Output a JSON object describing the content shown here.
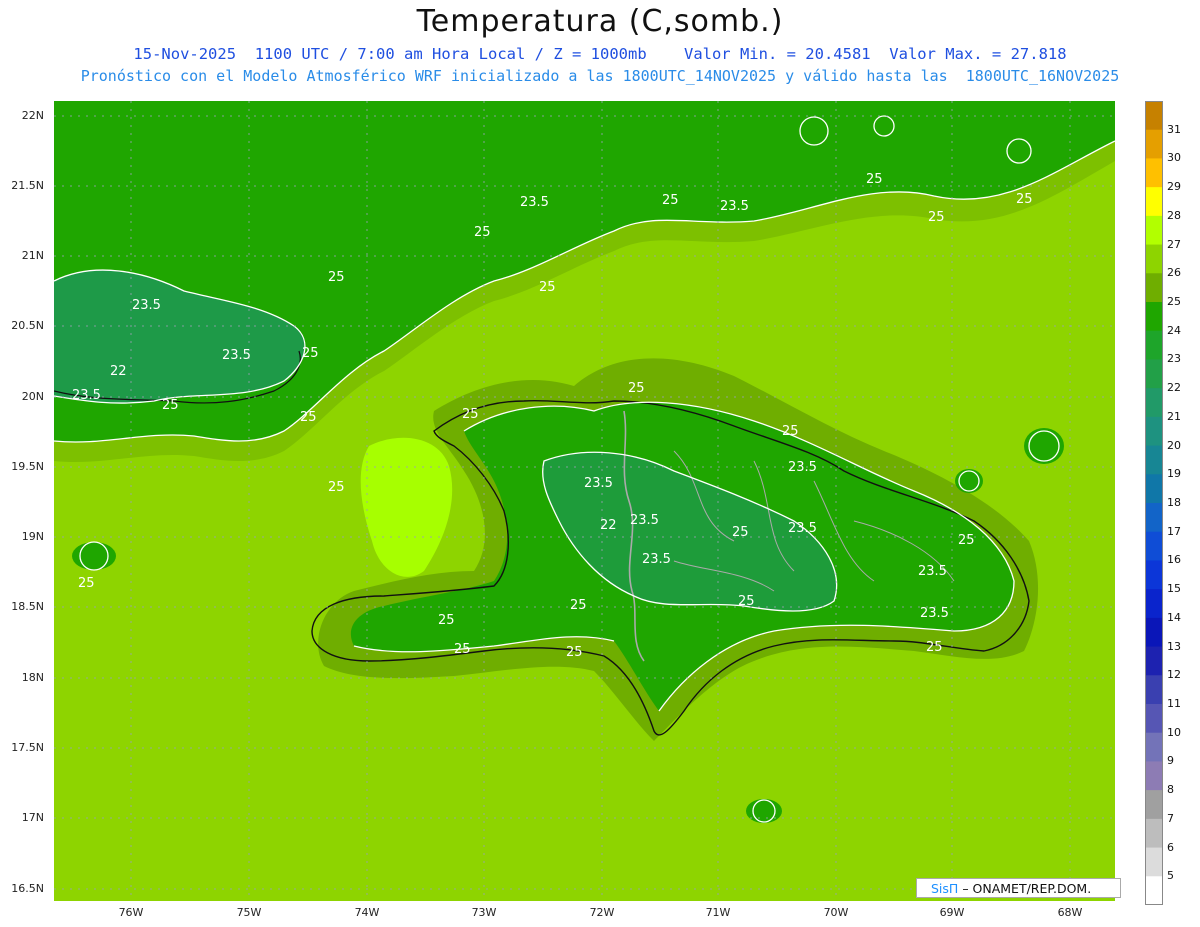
{
  "header": {
    "title": "Temperatura (C,somb.)",
    "subtitle_1": "15-Nov-2025  1100 UTC / 7:00 am Hora Local / Z = 1000mb    Valor Min. = 20.4581  Valor Max. = 27.818",
    "subtitle_2": "Pronóstico con el Modelo Atmosférico WRF inicializado a las 1800UTC_14NOV2025 y válido hasta las  1800UTC_16NOV2025"
  },
  "axes": {
    "y_labels": [
      "22N",
      "21.5N",
      "21N",
      "20.5N",
      "20N",
      "19.5N",
      "19N",
      "18.5N",
      "18N",
      "17.5N",
      "17N",
      "16.5N"
    ],
    "x_labels": [
      "76W",
      "75W",
      "74W",
      "73W",
      "72W",
      "71W",
      "70W",
      "69W",
      "68W"
    ]
  },
  "colorbar": {
    "labels": [
      "31",
      "30",
      "29",
      "28",
      "27",
      "26",
      "25",
      "24",
      "23",
      "22",
      "21",
      "20",
      "19",
      "18",
      "17",
      "16",
      "15",
      "14",
      "13",
      "12",
      "11",
      "10",
      "9",
      "8",
      "7",
      "6",
      "5"
    ],
    "colors": [
      "#c68100",
      "#e59f00",
      "#ffc000",
      "#ffff00",
      "#b2ff00",
      "#8ed400",
      "#6fae00",
      "#1fa600",
      "#1ea52a",
      "#22a048",
      "#219a68",
      "#1e9280",
      "#178694",
      "#1077a8",
      "#1264c8",
      "#0f4dd6",
      "#0c36d8",
      "#0a24cc",
      "#0a16b8",
      "#1d22b0",
      "#3a40b0",
      "#5656b4",
      "#7373b8",
      "#8d7cb4",
      "#a0a0a0",
      "#bdbdbd",
      "#dcdcdc",
      "#ffffff"
    ]
  },
  "contour_labels": [
    "25",
    "23.5",
    "22"
  ],
  "credit": {
    "brand": "SisΠ",
    "text": "– ONAMET/REP.DOM."
  },
  "colors": {
    "sea": "#8ed400",
    "sea_light": "#a7ff00",
    "land_low": "#6fae00",
    "land_mid": "#1fa600",
    "land_high": "#1e9a48",
    "contour": "#ffffff",
    "coast": "#111111",
    "border": "#aaaaaa",
    "grid": "#9aa0b8"
  }
}
